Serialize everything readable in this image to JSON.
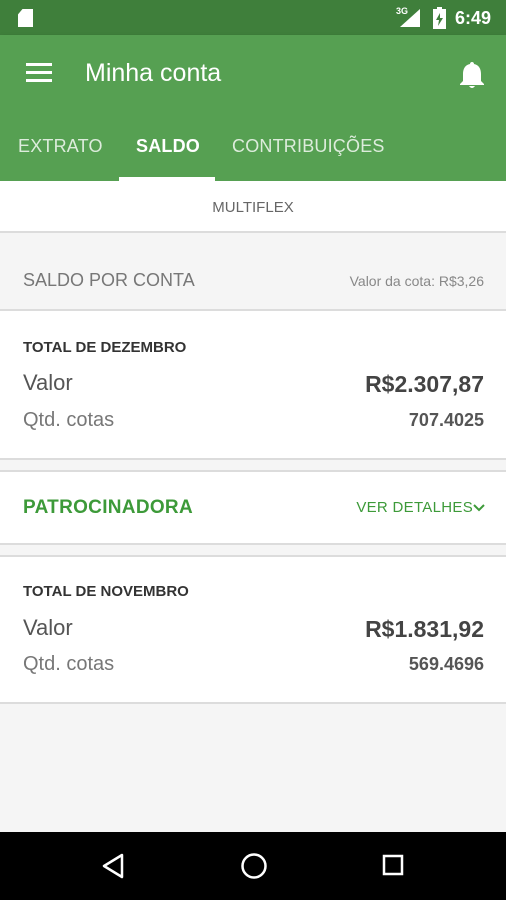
{
  "status_bar": {
    "network": "3G",
    "time": "6:49"
  },
  "app_bar": {
    "title": "Minha conta"
  },
  "tabs": [
    {
      "label": "EXTRATO",
      "active": false
    },
    {
      "label": "SALDO",
      "active": true
    },
    {
      "label": "CONTRIBUIÇÕES",
      "active": false
    }
  ],
  "plan": {
    "name": "MULTIFLEX"
  },
  "saldo": {
    "header": "SALDO POR CONTA",
    "cota_value": "Valor da cota: R$3,26"
  },
  "december": {
    "title": "TOTAL DE DEZEMBRO",
    "valor_label": "Valor",
    "valor": "R$2.307,87",
    "cotas_label": "Qtd. cotas",
    "cotas": "707.4025"
  },
  "sponsor": {
    "label": "PATROCINADORA",
    "details_link": "VER DETALHES"
  },
  "november": {
    "title": "TOTAL DE NOVEMBRO",
    "valor_label": "Valor",
    "valor": "R$1.831,92",
    "cotas_label": "Qtd. cotas",
    "cotas": "569.4696"
  },
  "icons": {
    "status": [
      "sd-card-icon",
      "signal-icon",
      "battery-icon"
    ],
    "app_bar": [
      "menu-icon",
      "bell-icon"
    ],
    "nav": [
      "back-icon",
      "home-icon",
      "recents-icon"
    ]
  },
  "colors": {
    "status_bar": "#3f7f3b",
    "app_bar": "#56a052",
    "accent": "#3d9a39"
  }
}
